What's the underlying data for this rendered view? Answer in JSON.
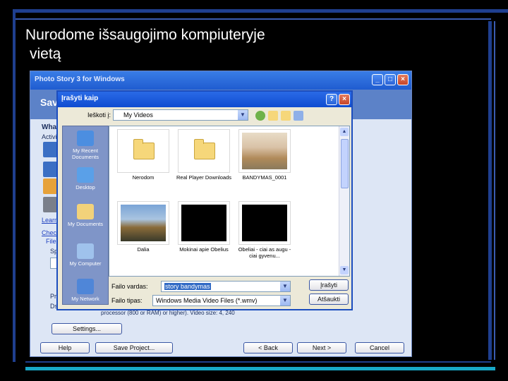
{
  "slide": {
    "title_line1": "Nurodome išsaugojimo kompiuteryje",
    "title_line2": "vietą"
  },
  "colors": {
    "slide_background": "#000000",
    "decor_bar": "#1f3f8f",
    "xp_title_blue": "#1f5cd0",
    "dialog_face": "#ece9d8"
  },
  "photostory": {
    "title": "Photo Story 3 for Windows",
    "header": "Save",
    "what_label": "Wha",
    "activity_label": "Activit",
    "learn_link": "Learn",
    "check_link": "Check",
    "file_label": "File",
    "sp_label": "Sp",
    "pr_label": "Pr",
    "ds_label": "Ds",
    "info_text": "processor (800 or RAM) or higher). Video size: 4, 240",
    "buttons": {
      "settings": "Settings...",
      "help": "Help",
      "save_project": "Save Project...",
      "back": "< Back",
      "next": "Next >",
      "cancel": "Cancel"
    }
  },
  "dialog": {
    "title": "Įrašyti kaip",
    "look_in_label": "Ieškoti į:",
    "look_in_value": "My Videos",
    "places": [
      {
        "label": "My Recent Documents",
        "icon": "recent-documents-icon"
      },
      {
        "label": "Desktop",
        "icon": "desktop-icon"
      },
      {
        "label": "My Documents",
        "icon": "my-documents-icon"
      },
      {
        "label": "My Computer",
        "icon": "my-computer-icon"
      },
      {
        "label": "My Network",
        "icon": "my-network-icon"
      }
    ],
    "files": [
      {
        "name": "Nerodom",
        "kind": "folder"
      },
      {
        "name": "Real Player Downloads",
        "kind": "folder"
      },
      {
        "name": "BANDYMAS_0001",
        "kind": "photo-kids"
      },
      {
        "name": "Dalia",
        "kind": "photo-castle"
      },
      {
        "name": "Mokinai apie Obelius",
        "kind": "video-black"
      },
      {
        "name": "Obeliai - ciai as augu - ciai gyvenu...",
        "kind": "video-black"
      }
    ],
    "filename_label": "Failo vardas:",
    "filename_value": "story bandymas",
    "filetype_label": "Failo tipas:",
    "filetype_value": "Windows Media Video Files (*.wmv)",
    "save_button": "Įrašyti",
    "cancel_button": "Atšaukti"
  }
}
